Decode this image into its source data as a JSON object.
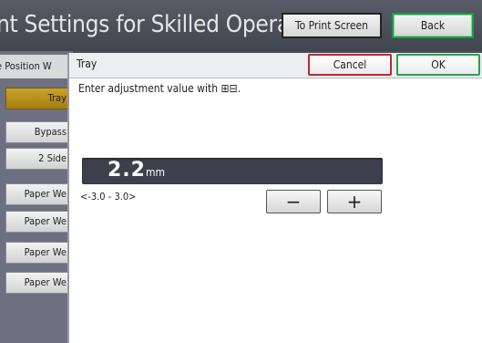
{
  "header": {
    "title": "nt Settings for Skilled Operators",
    "print_screen_label": "To Print Screen",
    "back_label": "Back"
  },
  "sidebar": {
    "header": "e Position W",
    "items": [
      {
        "label": "Tray",
        "selected": true
      },
      {
        "label": "Bypass",
        "selected": false
      },
      {
        "label": "2 Side",
        "selected": false
      },
      {
        "label": "Paper We",
        "selected": false
      },
      {
        "label": "Paper We",
        "selected": false
      },
      {
        "label": "Paper We",
        "selected": false
      },
      {
        "label": "Paper We",
        "selected": false
      }
    ]
  },
  "dialog": {
    "title": "Tray",
    "cancel_label": "Cancel",
    "ok_label": "OK",
    "instruction": "Enter adjustment value with ⊞⊟.",
    "value": "2.2",
    "unit": "mm",
    "range": "<-3.0 - 3.0>",
    "minus_label": "−",
    "plus_label": "+"
  },
  "colors": {
    "selected_item": "#b68f1c",
    "cancel_border": "#c0282c",
    "ok_border": "#27a24e",
    "value_field": "#3d3f4c"
  }
}
